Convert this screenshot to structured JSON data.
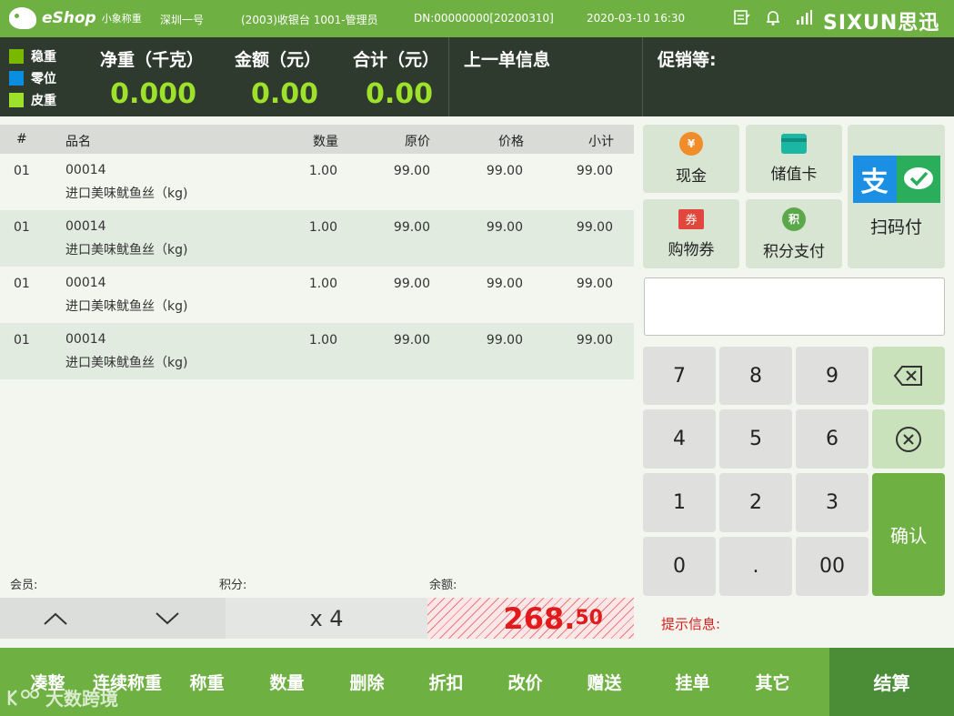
{
  "topbar": {
    "logo": "eShop",
    "logo_sub": "小象称重",
    "store": "深圳一号",
    "terminal": "(2003)收银台 1001-管理员",
    "dn": "DN:00000000[20200310]",
    "datetime": "2020-03-10 16:30",
    "brand": "SIXUN思迅"
  },
  "scale": {
    "legend": [
      {
        "label": "稳重",
        "color": "#7ab800"
      },
      {
        "label": "零位",
        "color": "#0a8fe0"
      },
      {
        "label": "皮重",
        "color": "#9ee12b"
      }
    ],
    "net_weight_label": "净重（千克）",
    "net_weight": "0.000",
    "amount_label": "金额（元）",
    "amount": "0.00",
    "total_label": "合计（元）",
    "total": "0.00",
    "last_order_label": "上一单信息",
    "promo_label": "促销等:"
  },
  "table": {
    "headers": {
      "idx": "#",
      "name": "品名",
      "qty": "数量",
      "orig": "原价",
      "price": "价格",
      "subtotal": "小计"
    },
    "rows": [
      {
        "idx": "01",
        "code": "00014",
        "name": "进口美味鱿鱼丝（kg)",
        "qty": "1.00",
        "orig": "99.00",
        "price": "99.00",
        "subtotal": "99.00"
      },
      {
        "idx": "01",
        "code": "00014",
        "name": "进口美味鱿鱼丝（kg)",
        "qty": "1.00",
        "orig": "99.00",
        "price": "99.00",
        "subtotal": "99.00"
      },
      {
        "idx": "01",
        "code": "00014",
        "name": "进口美味鱿鱼丝（kg)",
        "qty": "1.00",
        "orig": "99.00",
        "price": "99.00",
        "subtotal": "99.00"
      },
      {
        "idx": "01",
        "code": "00014",
        "name": "进口美味鱿鱼丝（kg)",
        "qty": "1.00",
        "orig": "99.00",
        "price": "99.00",
        "subtotal": "99.00"
      }
    ]
  },
  "footer": {
    "member_label": "会员:",
    "points_label": "积分:",
    "balance_label": "余额:",
    "count": "x 4",
    "total_int": "268.",
    "total_dec": "50"
  },
  "payment": {
    "cash": "现金",
    "card": "储值卡",
    "scan": "扫码付",
    "coupon": "购物券",
    "points": "积分支付"
  },
  "keypad": {
    "k7": "7",
    "k8": "8",
    "k9": "9",
    "k4": "4",
    "k5": "5",
    "k6": "6",
    "k1": "1",
    "k2": "2",
    "k3": "3",
    "k0": "0",
    "kdot": ".",
    "k00": "00",
    "confirm": "确认"
  },
  "hint": "提示信息:",
  "bottom": {
    "round": "凑整",
    "continuous": "连续称重",
    "weigh": "称重",
    "quantity": "数量",
    "delete": "删除",
    "discount": "折扣",
    "change_price": "改价",
    "gift": "赠送",
    "hold": "挂单",
    "other": "其它",
    "settle": "结算"
  },
  "watermark": "大数跨境"
}
